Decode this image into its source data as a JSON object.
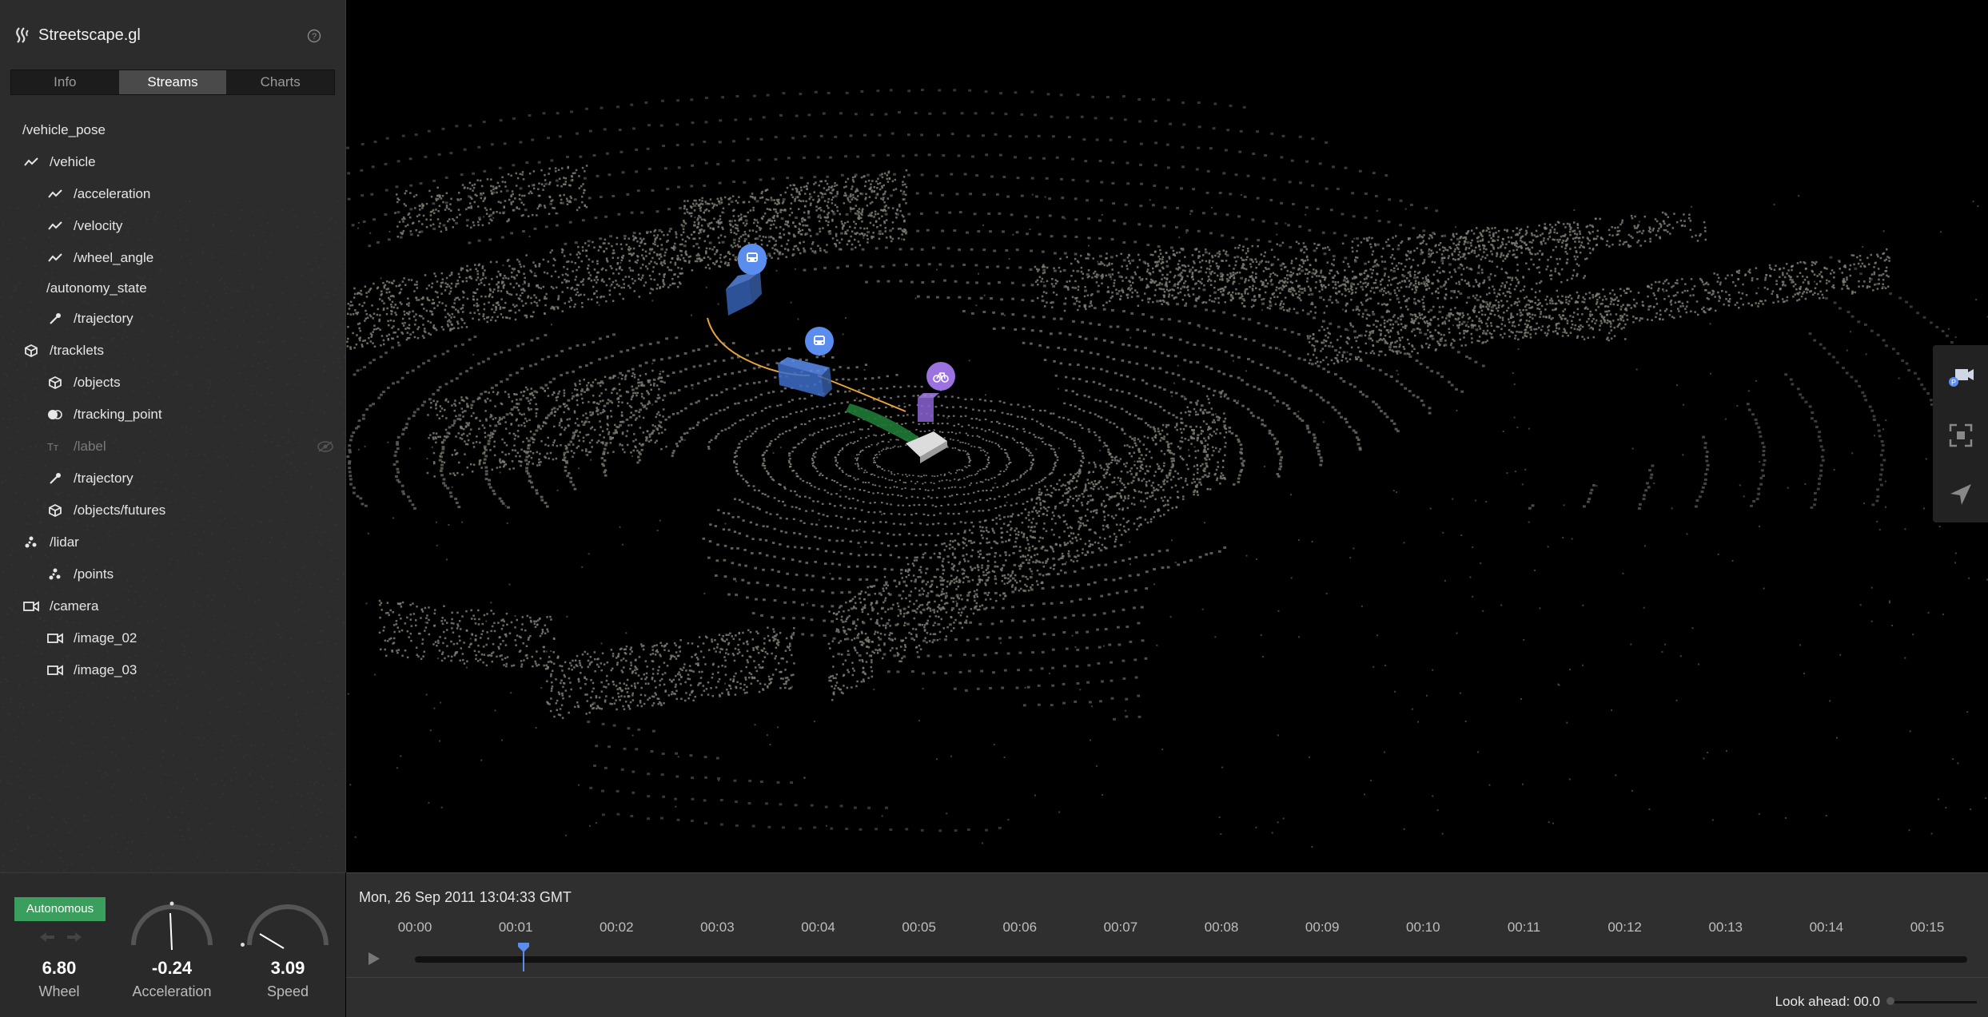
{
  "app": {
    "title": "Streetscape.gl"
  },
  "tabs": [
    {
      "label": "Info",
      "active": false
    },
    {
      "label": "Streams",
      "active": true
    },
    {
      "label": "Charts",
      "active": false
    }
  ],
  "streams": [
    {
      "label": "/vehicle_pose",
      "icon": "none",
      "level": 0
    },
    {
      "label": "/vehicle",
      "icon": "line-chart-icon",
      "level": 0
    },
    {
      "label": "/acceleration",
      "icon": "line-chart-icon",
      "level": 1
    },
    {
      "label": "/velocity",
      "icon": "line-chart-icon",
      "level": 1
    },
    {
      "label": "/wheel_angle",
      "icon": "line-chart-icon",
      "level": 1
    },
    {
      "label": "/autonomy_state",
      "icon": "none",
      "level": 1
    },
    {
      "label": "/trajectory",
      "icon": "path-icon",
      "level": 1
    },
    {
      "label": "/tracklets",
      "icon": "cube-icon",
      "level": 0
    },
    {
      "label": "/objects",
      "icon": "cube-icon",
      "level": 1
    },
    {
      "label": "/tracking_point",
      "icon": "point-icon",
      "level": 1
    },
    {
      "label": "/label",
      "icon": "text-icon",
      "level": 1,
      "dim": true
    },
    {
      "label": "/trajectory",
      "icon": "path-icon",
      "level": 1
    },
    {
      "label": "/objects/futures",
      "icon": "cube-icon",
      "level": 1
    },
    {
      "label": "/lidar",
      "icon": "pointcloud-icon",
      "level": 0
    },
    {
      "label": "/points",
      "icon": "pointcloud-icon",
      "level": 1
    },
    {
      "label": "/camera",
      "icon": "camera-icon",
      "level": 0
    },
    {
      "label": "/image_02",
      "icon": "camera-icon",
      "level": 1
    },
    {
      "label": "/image_03",
      "icon": "camera-icon",
      "level": 1
    }
  ],
  "hud": {
    "autonomy_badge": "Autonomous",
    "wheel": {
      "value": "6.80",
      "label": "Wheel"
    },
    "acceleration": {
      "value": "-0.24",
      "label": "Acceleration"
    },
    "speed": {
      "value": "3.09",
      "label": "Speed"
    }
  },
  "timeline": {
    "timestamp": "Mon, 26 Sep 2011 13:04:33 GMT",
    "ticks": [
      "00:00",
      "00:01",
      "00:02",
      "00:03",
      "00:04",
      "00:05",
      "00:06",
      "00:07",
      "00:08",
      "00:09",
      "00:10",
      "00:11",
      "00:12",
      "00:13",
      "00:14",
      "00:15"
    ],
    "current_time_fraction": 0.07,
    "look_ahead": "Look ahead: 00.0"
  },
  "colors": {
    "accent_blue": "#5b8def",
    "cyclist_purple": "#9b72e0",
    "autonomous_green": "#3a9f5c",
    "trajectory_orange": "#e8a33a",
    "lidar_gray": "#8a8a7e"
  }
}
